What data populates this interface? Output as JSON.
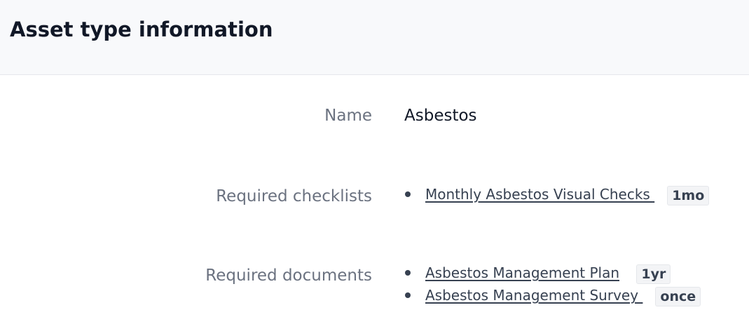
{
  "header": {
    "title": "Asset type information"
  },
  "fields": {
    "name_label": "Name",
    "name_value": "Asbestos",
    "checklists_label": "Required checklists",
    "documents_label": "Required documents"
  },
  "checklists": [
    {
      "label": "Monthly Asbestos Visual Checks ",
      "frequency": "1mo"
    }
  ],
  "documents": [
    {
      "label": "Asbestos Management Plan",
      "frequency": "1yr"
    },
    {
      "label": "Asbestos Management Survey ",
      "frequency": "once"
    }
  ]
}
